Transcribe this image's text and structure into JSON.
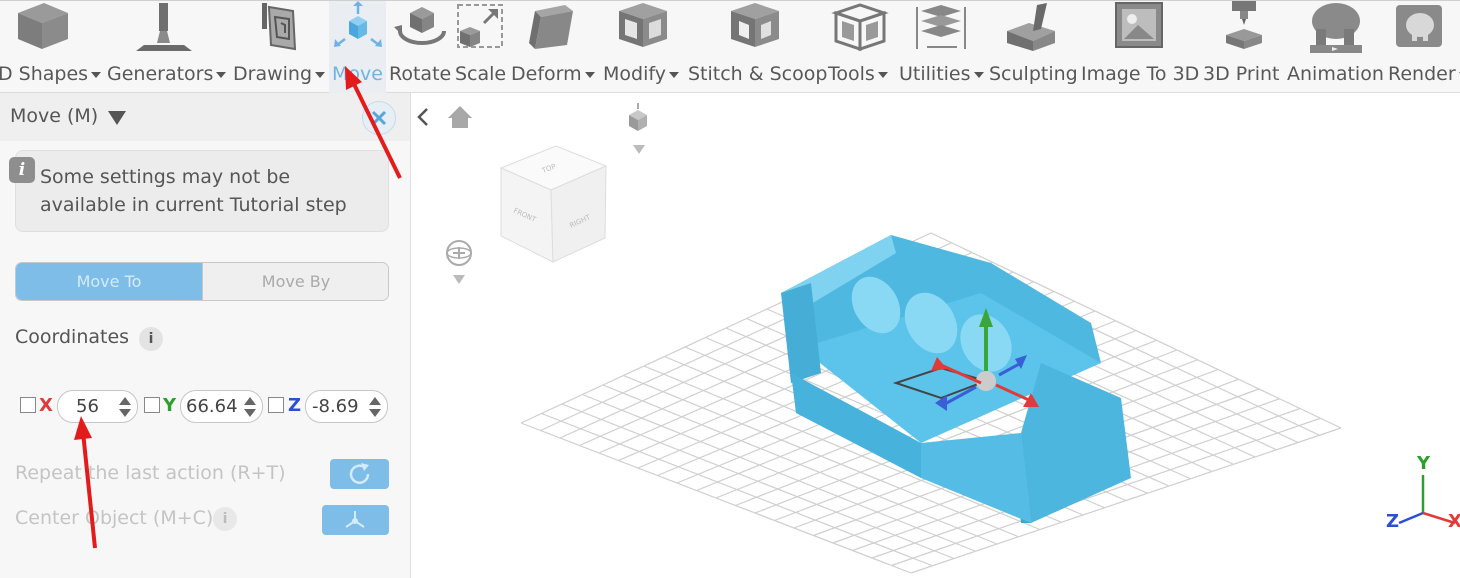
{
  "toolbar": {
    "items": [
      {
        "label": "D Shapes",
        "icon": "3d-shapes-icon",
        "dropdown": true
      },
      {
        "label": "Generators",
        "icon": "generators-icon",
        "dropdown": true
      },
      {
        "label": "Drawing",
        "icon": "drawing-icon",
        "dropdown": true
      },
      {
        "label": "Move",
        "icon": "move-icon",
        "dropdown": false,
        "active": true
      },
      {
        "label": "Rotate",
        "icon": "rotate-icon",
        "dropdown": false
      },
      {
        "label": "Scale",
        "icon": "scale-icon",
        "dropdown": false
      },
      {
        "label": "Deform",
        "icon": "deform-icon",
        "dropdown": true
      },
      {
        "label": "Modify",
        "icon": "modify-icon",
        "dropdown": true
      },
      {
        "label": "Stitch & Scoop",
        "icon": "stitch-scoop-icon",
        "dropdown": false
      },
      {
        "label": "Tools",
        "icon": "tools-icon",
        "dropdown": true
      },
      {
        "label": "Utilities",
        "icon": "utilities-icon",
        "dropdown": true
      },
      {
        "label": "Sculpting",
        "icon": "sculpting-icon",
        "dropdown": false
      },
      {
        "label": "Image To 3D",
        "icon": "image-to-3d-icon",
        "dropdown": false
      },
      {
        "label": "3D Print",
        "icon": "3d-print-icon",
        "dropdown": false
      },
      {
        "label": "Animation",
        "icon": "animation-icon",
        "dropdown": false
      },
      {
        "label": "Render",
        "icon": "render-icon",
        "dropdown": true
      }
    ]
  },
  "panel": {
    "title": "Move (M)",
    "info_text": "Some settings may not be available in current Tutorial step",
    "segment": {
      "move_to": "Move To",
      "move_by": "Move By",
      "selected": "Move To"
    },
    "coordinates_label": "Coordinates",
    "coords": {
      "x_label": "X",
      "x_value": "56",
      "y_label": "Y",
      "y_value": "66.64",
      "z_label": "Z",
      "z_value": "-8.69"
    },
    "repeat_label": "Repeat the last action (R+T)",
    "center_label": "Center Object (M+C)"
  },
  "viewport": {
    "cube_faces": {
      "top": "TOP",
      "front": "FRONT",
      "right": "RIGHT"
    },
    "axes": {
      "x": "X",
      "y": "Y",
      "z": "Z"
    },
    "object_color": "#5bc4ea"
  },
  "colors": {
    "accent": "#7dbde8",
    "axis_x": "#e03a3a",
    "axis_y": "#2f9e2f",
    "axis_z": "#2a4fd6",
    "annotation_arrow": "#e41b1b"
  }
}
